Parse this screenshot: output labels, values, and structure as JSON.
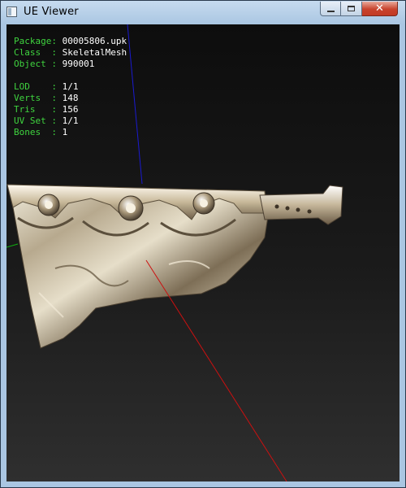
{
  "window": {
    "title": "UE Viewer",
    "controls": {
      "minimize": "minimize",
      "maximize": "maximize",
      "close": "close"
    }
  },
  "viewport": {
    "info_group_1": [
      {
        "key": "Package: ",
        "value": "00005806.upk"
      },
      {
        "key": "Class  : ",
        "value": "SkeletalMesh"
      },
      {
        "key": "Object : ",
        "value": "990001"
      }
    ],
    "info_group_2": [
      {
        "key": "LOD    : ",
        "value": "1/1"
      },
      {
        "key": "Verts  : ",
        "value": "148"
      },
      {
        "key": "Tris   : ",
        "value": "156"
      },
      {
        "key": "UV Set : ",
        "value": "1/1"
      },
      {
        "key": "Bones  : ",
        "value": "1"
      }
    ],
    "colors": {
      "label": "#3fd43f",
      "value": "#ffffff",
      "axis_x": "#cc1010",
      "axis_y": "#10b010",
      "axis_z": "#1a1ad0"
    },
    "model": "cleaver-blade"
  }
}
